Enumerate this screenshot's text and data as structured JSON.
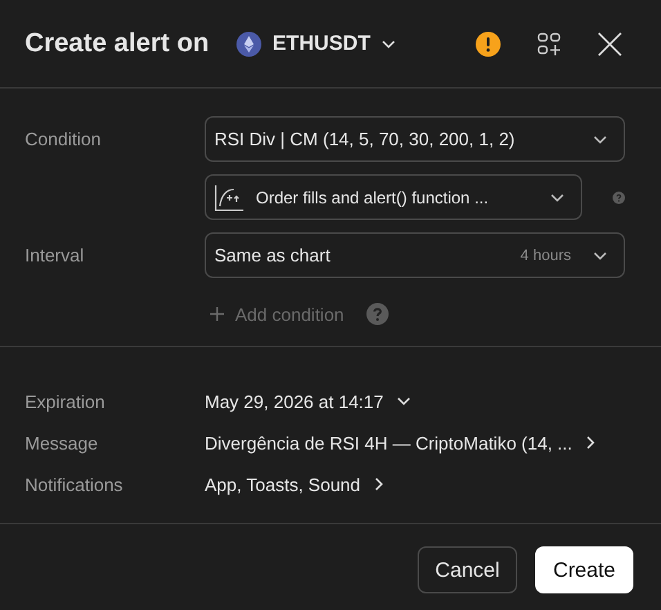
{
  "header": {
    "title": "Create alert on",
    "symbol": "ETHUSDT"
  },
  "condition": {
    "label": "Condition",
    "indicator": "RSI Div | CM (14, 5, 70, 30, 200, 1, 2)",
    "trigger": "Order fills and alert() function ..."
  },
  "interval": {
    "label": "Interval",
    "value": "Same as chart",
    "hint": "4 hours"
  },
  "add_condition": {
    "label": "Add condition",
    "disabled": true
  },
  "settings": [
    {
      "label": "Expiration",
      "value": "May 29, 2026 at 14:17",
      "kind": "dropdown"
    },
    {
      "label": "Message",
      "value": "Divergência de RSI 4H — CriptoMatiko (14, ...",
      "kind": "link"
    },
    {
      "label": "Notifications",
      "value": "App, Toasts, Sound",
      "kind": "link"
    }
  ],
  "buttons": [
    {
      "label": "Cancel",
      "kind": "secondary"
    },
    {
      "label": "Create",
      "kind": "primary"
    }
  ]
}
